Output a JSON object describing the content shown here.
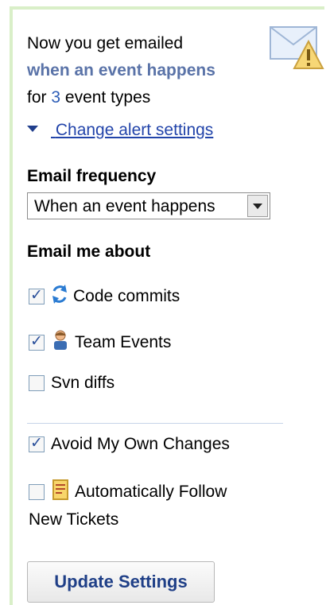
{
  "summary": {
    "line1": "Now you get emailed",
    "frequency": "when an event happens",
    "prefix_for": "for",
    "event_type_count": "3",
    "suffix_types": "event types"
  },
  "toggle": {
    "label": "Change alert settings",
    "caret_icon": "caret-down-icon"
  },
  "alert_icon": "email-warning-icon",
  "email_frequency": {
    "label": "Email frequency",
    "selected": "When an event happens"
  },
  "email_me_about": {
    "label": "Email me about",
    "options": [
      {
        "label": "Code commits",
        "checked": true,
        "icon": "sync-icon"
      },
      {
        "label": "Team Events",
        "checked": true,
        "icon": "user-icon"
      },
      {
        "label": "Svn diffs",
        "checked": false,
        "icon": null
      }
    ]
  },
  "extra": {
    "avoid_own": {
      "label": "Avoid My Own Changes",
      "checked": true
    },
    "follow": {
      "label_line1": "Automatically Follow",
      "label_line2": "New Tickets",
      "checked": false,
      "icon": "ticket-icon"
    }
  },
  "buttons": {
    "update": "Update Settings"
  },
  "colors": {
    "accent": "#5a73a8",
    "link": "#2244aa",
    "panel_border": "#d9efc8"
  }
}
